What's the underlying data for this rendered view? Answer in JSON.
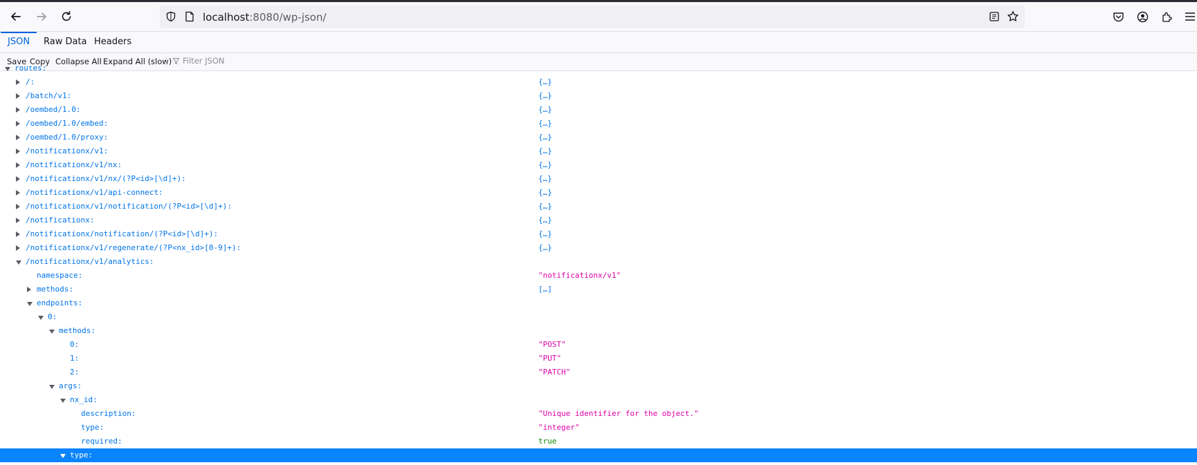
{
  "browser": {
    "url_host": "localhost",
    "url_rest": ":8080/wp-json/"
  },
  "tabs": [
    {
      "label": "JSON",
      "selected": true
    },
    {
      "label": "Raw Data",
      "selected": false
    },
    {
      "label": "Headers",
      "selected": false
    }
  ],
  "toolbar": {
    "save": "Save",
    "copy": "Copy",
    "collapse_all": "Collapse All",
    "expand_all": "Expand All (slow)",
    "filter_placeholder": "Filter JSON"
  },
  "tree": [
    {
      "key": "routes:",
      "depth": 0,
      "state": "open",
      "value": "",
      "vtype": ""
    },
    {
      "key": "/:",
      "depth": 1,
      "state": "closed",
      "value": "{…}",
      "vtype": "obj"
    },
    {
      "key": "/batch/v1:",
      "depth": 1,
      "state": "closed",
      "value": "{…}",
      "vtype": "obj"
    },
    {
      "key": "/oembed/1.0:",
      "depth": 1,
      "state": "closed",
      "value": "{…}",
      "vtype": "obj"
    },
    {
      "key": "/oembed/1.0/embed:",
      "depth": 1,
      "state": "closed",
      "value": "{…}",
      "vtype": "obj"
    },
    {
      "key": "/oembed/1.0/proxy:",
      "depth": 1,
      "state": "closed",
      "value": "{…}",
      "vtype": "obj"
    },
    {
      "key": "/notificationx/v1:",
      "depth": 1,
      "state": "closed",
      "value": "{…}",
      "vtype": "obj"
    },
    {
      "key": "/notificationx/v1/nx:",
      "depth": 1,
      "state": "closed",
      "value": "{…}",
      "vtype": "obj"
    },
    {
      "key": "/notificationx/v1/nx/(?P<id>[\\d]+):",
      "depth": 1,
      "state": "closed",
      "value": "{…}",
      "vtype": "obj"
    },
    {
      "key": "/notificationx/v1/api-connect:",
      "depth": 1,
      "state": "closed",
      "value": "{…}",
      "vtype": "obj"
    },
    {
      "key": "/notificationx/v1/notification/(?P<id>[\\d]+):",
      "depth": 1,
      "state": "closed",
      "value": "{…}",
      "vtype": "obj"
    },
    {
      "key": "/notificationx:",
      "depth": 1,
      "state": "closed",
      "value": "{…}",
      "vtype": "obj"
    },
    {
      "key": "/notificationx/notification/(?P<id>[\\d]+):",
      "depth": 1,
      "state": "closed",
      "value": "{…}",
      "vtype": "obj"
    },
    {
      "key": "/notificationx/v1/regenerate/(?P<nx_id>[0-9]+):",
      "depth": 1,
      "state": "closed",
      "value": "{…}",
      "vtype": "obj"
    },
    {
      "key": "/notificationx/v1/analytics:",
      "depth": 1,
      "state": "open",
      "value": "",
      "vtype": ""
    },
    {
      "key": "namespace:",
      "depth": 2,
      "state": "leaf",
      "value": "\"notificationx/v1\"",
      "vtype": "str"
    },
    {
      "key": "methods:",
      "depth": 2,
      "state": "closed",
      "value": "[…]",
      "vtype": "obj"
    },
    {
      "key": "endpoints:",
      "depth": 2,
      "state": "open",
      "value": "",
      "vtype": ""
    },
    {
      "key": "0:",
      "depth": 3,
      "state": "open",
      "value": "",
      "vtype": ""
    },
    {
      "key": "methods:",
      "depth": 4,
      "state": "open",
      "value": "",
      "vtype": ""
    },
    {
      "key": "0:",
      "depth": 5,
      "state": "leaf",
      "value": "\"POST\"",
      "vtype": "str"
    },
    {
      "key": "1:",
      "depth": 5,
      "state": "leaf",
      "value": "\"PUT\"",
      "vtype": "str"
    },
    {
      "key": "2:",
      "depth": 5,
      "state": "leaf",
      "value": "\"PATCH\"",
      "vtype": "str"
    },
    {
      "key": "args:",
      "depth": 4,
      "state": "open",
      "value": "",
      "vtype": ""
    },
    {
      "key": "nx_id:",
      "depth": 5,
      "state": "open",
      "value": "",
      "vtype": ""
    },
    {
      "key": "description:",
      "depth": 6,
      "state": "leaf",
      "value": "\"Unique identifier for the object.\"",
      "vtype": "str"
    },
    {
      "key": "type:",
      "depth": 6,
      "state": "leaf",
      "value": "\"integer\"",
      "vtype": "str"
    },
    {
      "key": "required:",
      "depth": 6,
      "state": "leaf",
      "value": "true",
      "vtype": "bool"
    },
    {
      "key": "type:",
      "depth": 5,
      "state": "open",
      "value": "",
      "vtype": "",
      "selected": true
    }
  ]
}
